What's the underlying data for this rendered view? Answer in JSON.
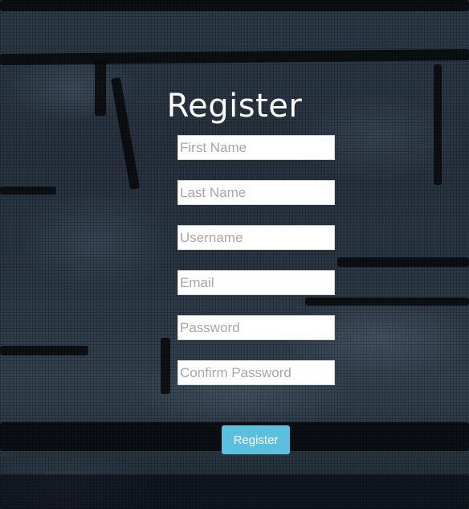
{
  "page": {
    "title": "Register"
  },
  "fields": [
    {
      "placeholder": "First Name",
      "value": ""
    },
    {
      "placeholder": "Last Name",
      "value": ""
    },
    {
      "placeholder": "Username",
      "value": ""
    },
    {
      "placeholder": "Email",
      "value": ""
    },
    {
      "placeholder": "Password",
      "value": ""
    },
    {
      "placeholder": "Confirm Password",
      "value": ""
    }
  ],
  "submit": {
    "label": "Register"
  },
  "colors": {
    "button_bg": "#5bc0de",
    "title_text": "#ffffff",
    "background": "#23303d"
  }
}
